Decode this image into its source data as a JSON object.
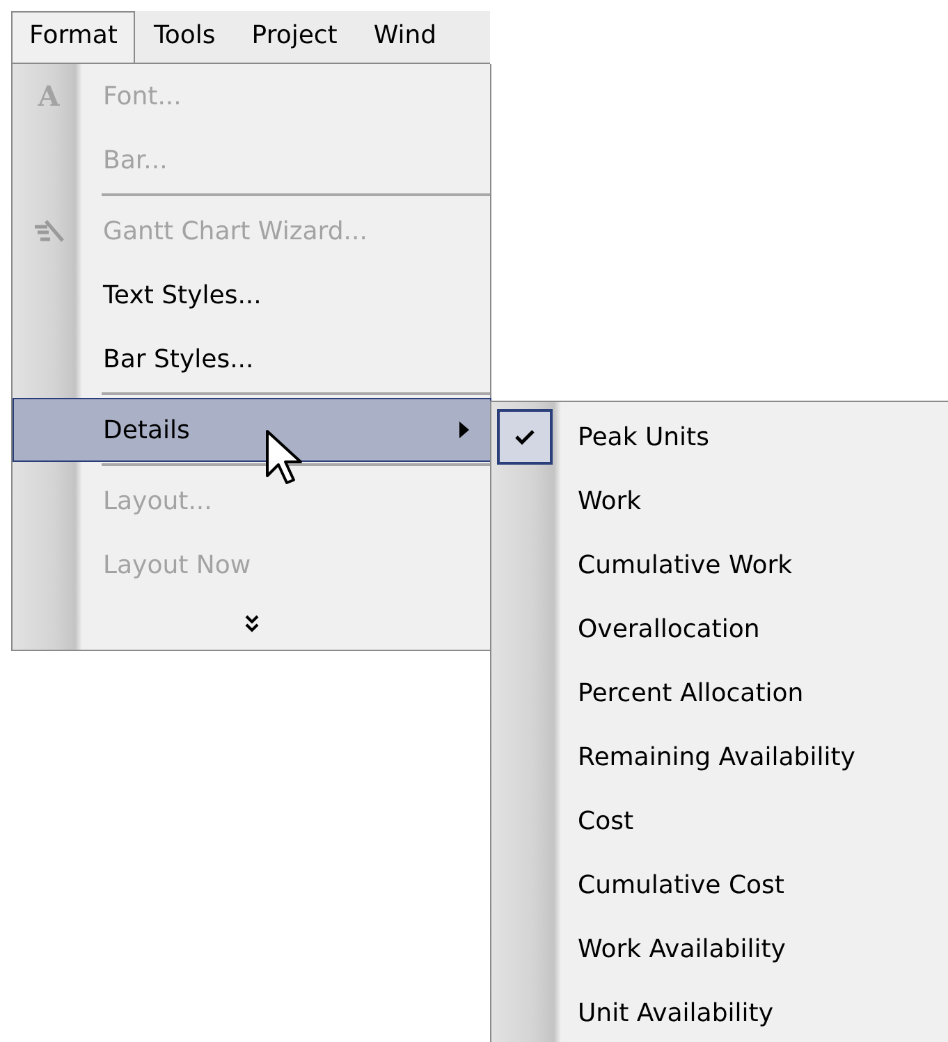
{
  "menu_bar": [
    {
      "label": "Format",
      "selected": true
    },
    {
      "label": "Tools",
      "selected": false
    },
    {
      "label": "Project",
      "selected": false
    },
    {
      "label": "Wind",
      "selected": false
    }
  ],
  "menu": [
    {
      "kind": "item",
      "label": "Font...",
      "disabled": true,
      "selected": false,
      "icon_text": "A"
    },
    {
      "kind": "item",
      "label": "Bar...",
      "disabled": true,
      "selected": false
    },
    {
      "kind": "separator"
    },
    {
      "kind": "item",
      "label": "Gantt Chart Wizard...",
      "disabled": true,
      "selected": false
    },
    {
      "kind": "item",
      "label": "Text Styles...",
      "disabled": false,
      "selected": false
    },
    {
      "kind": "item",
      "label": "Bar Styles...",
      "disabled": false,
      "selected": false
    },
    {
      "kind": "separator"
    },
    {
      "kind": "item",
      "label": "Details",
      "disabled": false,
      "selected": true,
      "submenu": true
    },
    {
      "kind": "separator"
    },
    {
      "kind": "item",
      "label": "Layout...",
      "disabled": true,
      "selected": false
    },
    {
      "kind": "item",
      "label": "Layout Now",
      "disabled": true,
      "selected": false
    },
    {
      "kind": "more"
    }
  ],
  "submenu": [
    {
      "label": "Peak Units",
      "checked": true
    },
    {
      "label": "Work",
      "checked": false
    },
    {
      "label": "Cumulative Work",
      "checked": false
    },
    {
      "label": "Overallocation",
      "checked": false
    },
    {
      "label": "Percent Allocation",
      "checked": false
    },
    {
      "label": "Remaining Availability",
      "checked": false
    },
    {
      "label": "Cost",
      "checked": false
    },
    {
      "label": "Cumulative Cost",
      "checked": false
    },
    {
      "label": "Work Availability",
      "checked": false
    },
    {
      "label": "Unit Availability",
      "checked": false
    }
  ]
}
